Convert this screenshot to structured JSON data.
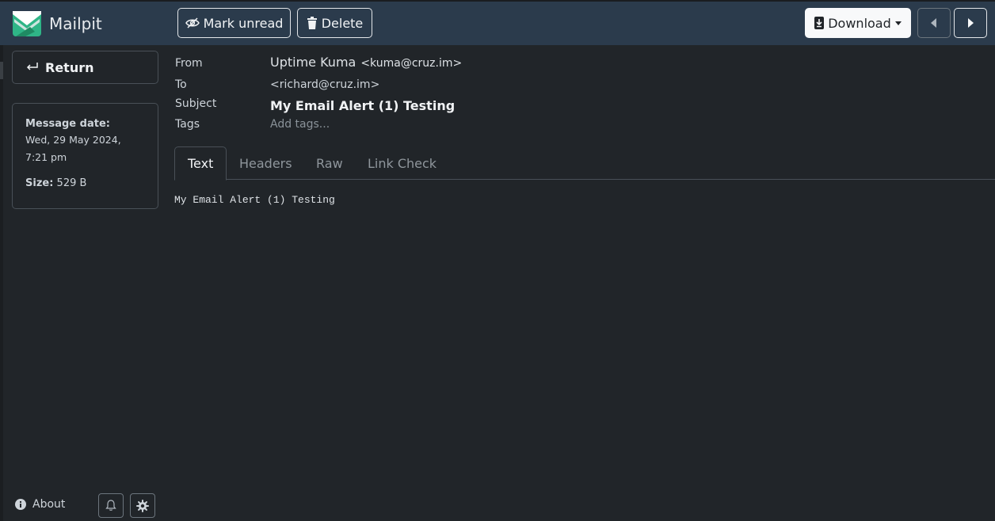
{
  "app": {
    "name": "Mailpit"
  },
  "toolbar": {
    "mark_unread_label": "Mark unread",
    "delete_label": "Delete",
    "download_label": "Download"
  },
  "sidebar": {
    "return_label": "Return",
    "message_date_label": "Message date:",
    "message_date_value": "Wed, 29 May 2024, 7:21 pm",
    "size_label": "Size:",
    "size_value": "529 B",
    "about_label": "About"
  },
  "message": {
    "from_label": "From",
    "from_name": "Uptime Kuma",
    "from_address": "<kuma@cruz.im>",
    "to_label": "To",
    "to_address": "<richard@cruz.im>",
    "subject_label": "Subject",
    "subject": "My Email Alert (1) Testing",
    "tags_label": "Tags",
    "tags_placeholder": "Add tags...",
    "body_text": "My Email Alert (1) Testing"
  },
  "tabs": [
    {
      "label": "Text",
      "active": true
    },
    {
      "label": "Headers",
      "active": false
    },
    {
      "label": "Raw",
      "active": false
    },
    {
      "label": "Link Check",
      "active": false
    }
  ],
  "colors": {
    "topbar": "#2b3b4c",
    "background": "#212529",
    "logo_green": "#2fb587"
  },
  "icons": [
    "mailpit-logo-icon",
    "eye-slash-icon",
    "trash-icon",
    "download-file-icon",
    "caret-down-icon",
    "chevron-left-icon",
    "chevron-right-icon",
    "return-arrow-icon",
    "info-icon",
    "bell-icon",
    "gear-icon"
  ]
}
